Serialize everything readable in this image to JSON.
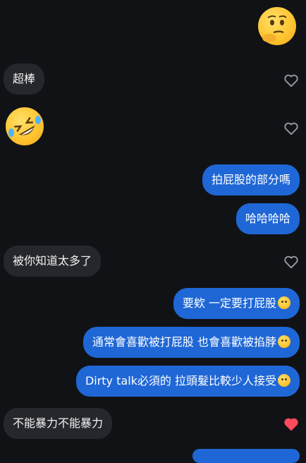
{
  "messages": [
    {
      "type": "emoji",
      "side": "out",
      "emoji": "thinking-face"
    },
    {
      "type": "text",
      "side": "in",
      "text": "超棒",
      "liked": false
    },
    {
      "type": "emoji",
      "side": "in",
      "emoji": "rolling-on-floor-laughing",
      "liked": false
    },
    {
      "type": "text",
      "side": "out",
      "text": "拍屁股的部分嗎"
    },
    {
      "type": "text",
      "side": "out",
      "text": "哈哈哈哈"
    },
    {
      "type": "text",
      "side": "in",
      "text": "被你知道太多了",
      "liked": false
    },
    {
      "type": "text",
      "side": "out",
      "text": "要欸 一定要打屁股",
      "emoji_suffix": "pleading-face"
    },
    {
      "type": "text",
      "side": "out",
      "text": "通常會喜歡被打屁股 也會喜歡被掐脖",
      "emoji_suffix": "thinking-face"
    },
    {
      "type": "text",
      "side": "out",
      "text": "Dirty talk必須的 拉頭髮比較少人接受",
      "emoji_suffix": "thinking-face"
    },
    {
      "type": "text",
      "side": "in",
      "text": "不能暴力不能暴力",
      "liked": true
    }
  ],
  "colors": {
    "background": "#111216",
    "incoming_bubble": "#26272c",
    "outgoing_bubble": "#1f67d6",
    "heart_outline": "#9a9ba1",
    "heart_liked": "#ff4b5c"
  }
}
